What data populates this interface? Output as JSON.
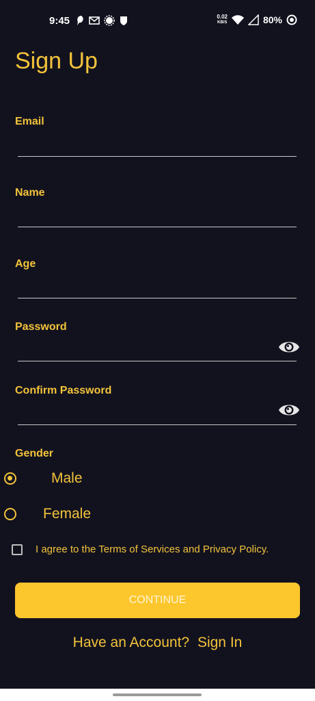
{
  "status_bar": {
    "time": "9:45",
    "net_speed_value": "0.02",
    "net_speed_unit": "KB/S",
    "battery": "80%"
  },
  "title": "Sign Up",
  "fields": {
    "email": {
      "label": "Email",
      "value": ""
    },
    "name": {
      "label": "Name",
      "value": ""
    },
    "age": {
      "label": "Age",
      "value": ""
    },
    "password": {
      "label": "Password",
      "value": ""
    },
    "confirm_password": {
      "label": "Confirm Password",
      "value": ""
    }
  },
  "gender": {
    "label": "Gender",
    "options": [
      {
        "label": "Male",
        "selected": true
      },
      {
        "label": "Female",
        "selected": false
      }
    ]
  },
  "terms": {
    "label": "I agree to the Terms of Services and Privacy Policy.",
    "checked": false
  },
  "continue_label": "CONTINUE",
  "signin": {
    "prompt": "Have an Account?",
    "link": "Sign In"
  },
  "colors": {
    "background": "#12121f",
    "accent": "#f3c33a",
    "button": "#fcc62d"
  }
}
